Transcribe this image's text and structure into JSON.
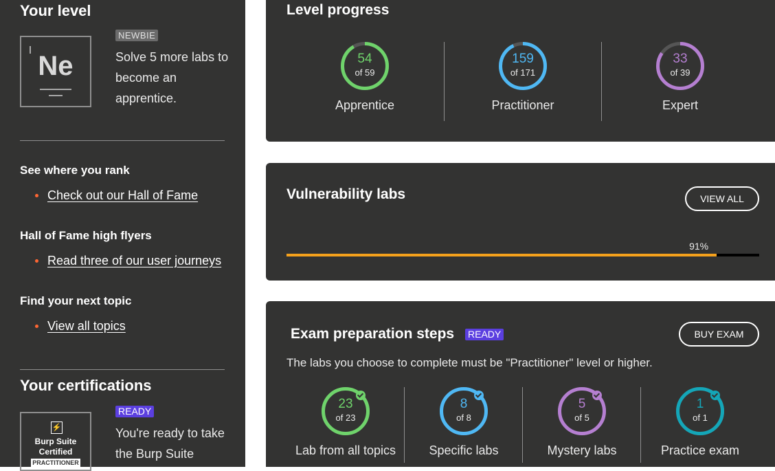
{
  "sidebar": {
    "your_level_heading": "Your level",
    "level_symbol": "Ne",
    "level_badge": "NEWBIE",
    "level_message": "Solve 5 more labs to become an apprentice.",
    "rank_heading": "See where you rank",
    "rank_link": "Check out our Hall of Fame",
    "flyers_heading": "Hall of Fame high flyers",
    "flyers_link": "Read three of our user journeys",
    "topic_heading": "Find your next topic",
    "topic_link": "View all topics",
    "certs_heading": "Your certifications",
    "cert_badge_line1": "Burp Suite",
    "cert_badge_line2": "Certified",
    "cert_badge_line3": "PRACTITIONER",
    "cert_ready_badge": "READY",
    "cert_message": "You're ready to take the Burp Suite"
  },
  "level_progress": {
    "title": "Level progress",
    "items": [
      {
        "name": "Apprentice",
        "solved": "54",
        "of_text": "of 59",
        "fraction": 0.915,
        "color": "#6fd36b"
      },
      {
        "name": "Practitioner",
        "solved": "159",
        "of_text": "of 171",
        "fraction": 0.93,
        "color": "#4fb8f4"
      },
      {
        "name": "Expert",
        "solved": "33",
        "of_text": "of 39",
        "fraction": 0.846,
        "color": "#b57fd1"
      }
    ]
  },
  "vuln_labs": {
    "title": "Vulnerability labs",
    "view_all_label": "VIEW ALL",
    "progress_text": "91%",
    "progress": 0.91,
    "bar_color": "#f5a11c"
  },
  "exam": {
    "title": "Exam preparation steps",
    "ready_badge": "READY",
    "buy_label": "BUY EXAM",
    "subtitle": "The labs you choose to complete must be \"Practitioner\" level or higher.",
    "steps": [
      {
        "label": "Lab from all topics",
        "solved": "23",
        "of_text": "of 23",
        "fraction": 1,
        "color": "#6fd36b"
      },
      {
        "label": "Specific labs",
        "solved": "8",
        "of_text": "of 8",
        "fraction": 1,
        "color": "#4fb8f4"
      },
      {
        "label": "Mystery labs",
        "solved": "5",
        "of_text": "of 5",
        "fraction": 1,
        "color": "#b57fd1"
      },
      {
        "label": "Practice exam",
        "solved": "1",
        "of_text": "of 1",
        "fraction": 1,
        "color": "#14a6b8"
      }
    ]
  },
  "colors": {
    "panel_bg": "#333332",
    "ready_badge_bg": "#5b3fe0",
    "bullet": "#ff6633",
    "ring_track": "#555555"
  }
}
